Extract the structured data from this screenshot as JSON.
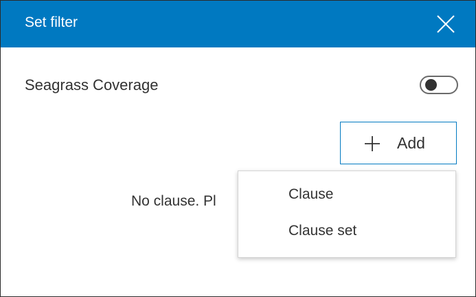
{
  "dialog": {
    "title": "Set filter",
    "close_icon": "close-icon"
  },
  "layer": {
    "name": "Seagrass Coverage",
    "toggle_on": false
  },
  "add_button": {
    "label": "Add",
    "icon": "plus-icon"
  },
  "empty_message": "No clause. Pl",
  "add_menu": {
    "items": [
      {
        "label": "Clause"
      },
      {
        "label": "Clause set"
      }
    ]
  },
  "colors": {
    "header": "#0079c1",
    "text": "#323232",
    "accent_border": "#0079c1"
  }
}
